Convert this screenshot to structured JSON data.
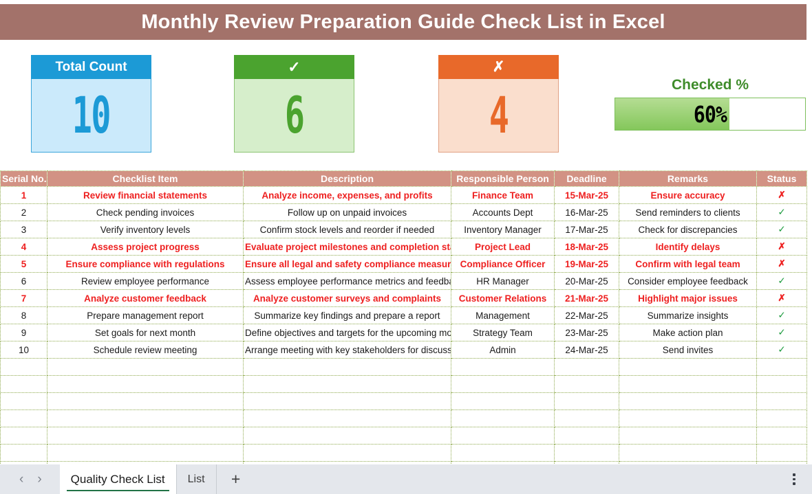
{
  "title": {
    "text": "Monthly Review Preparation Guide Check List in Excel"
  },
  "kpis": {
    "total": {
      "label": "Total Count",
      "value": "10",
      "color": "#1c9ad6"
    },
    "checked": {
      "label": "✓",
      "value": "6",
      "color": "#4ba32f"
    },
    "unchecked": {
      "label": "✗",
      "value": "4",
      "color": "#e8692a"
    }
  },
  "progress": {
    "label": "Checked %",
    "value_text": "60%",
    "percent": 60,
    "color": "#84c75b"
  },
  "table": {
    "headers": [
      "Serial No.",
      "Checklist Item",
      "Description",
      "Responsible Person",
      "Deadline",
      "Remarks",
      "Status"
    ],
    "rows": [
      {
        "serial": "1",
        "item": "Review financial statements",
        "desc": "Analyze income, expenses, and profits",
        "person": "Finance Team",
        "deadline": "15-Mar-25",
        "remarks": "Ensure accuracy",
        "status": "✗",
        "checked": false
      },
      {
        "serial": "2",
        "item": "Check pending invoices",
        "desc": "Follow up on unpaid invoices",
        "person": "Accounts Dept",
        "deadline": "16-Mar-25",
        "remarks": "Send reminders to clients",
        "status": "✓",
        "checked": true
      },
      {
        "serial": "3",
        "item": "Verify inventory levels",
        "desc": "Confirm stock levels and reorder if needed",
        "person": "Inventory Manager",
        "deadline": "17-Mar-25",
        "remarks": "Check for discrepancies",
        "status": "✓",
        "checked": true
      },
      {
        "serial": "4",
        "item": "Assess project progress",
        "desc": "Evaluate project milestones and completion status",
        "person": "Project Lead",
        "deadline": "18-Mar-25",
        "remarks": "Identify delays",
        "status": "✗",
        "checked": false
      },
      {
        "serial": "5",
        "item": "Ensure compliance with regulations",
        "desc": "Ensure all legal and safety compliance measures are met",
        "person": "Compliance Officer",
        "deadline": "19-Mar-25",
        "remarks": "Confirm with legal team",
        "status": "✗",
        "checked": false
      },
      {
        "serial": "6",
        "item": "Review employee performance",
        "desc": "Assess employee performance metrics and feedback",
        "person": "HR Manager",
        "deadline": "20-Mar-25",
        "remarks": "Consider employee feedback",
        "status": "✓",
        "checked": true
      },
      {
        "serial": "7",
        "item": "Analyze customer feedback",
        "desc": "Analyze customer surveys and complaints",
        "person": "Customer Relations",
        "deadline": "21-Mar-25",
        "remarks": "Highlight major issues",
        "status": "✗",
        "checked": false
      },
      {
        "serial": "8",
        "item": "Prepare management report",
        "desc": "Summarize key findings and prepare a report",
        "person": "Management",
        "deadline": "22-Mar-25",
        "remarks": "Summarize insights",
        "status": "✓",
        "checked": true
      },
      {
        "serial": "9",
        "item": "Set goals for next month",
        "desc": "Define objectives and targets for the upcoming month",
        "person": "Strategy Team",
        "deadline": "23-Mar-25",
        "remarks": "Make action plan",
        "status": "✓",
        "checked": true
      },
      {
        "serial": "10",
        "item": "Schedule review meeting",
        "desc": "Arrange meeting with key stakeholders for discussion",
        "person": "Admin",
        "deadline": "24-Mar-25",
        "remarks": "Send invites",
        "status": "✓",
        "checked": true
      }
    ],
    "empty_row_count": 7
  },
  "tabbar": {
    "prev_icon": "‹",
    "next_icon": "›",
    "tabs": [
      {
        "label": "Quality Check List",
        "active": true
      },
      {
        "label": "List",
        "active": false
      }
    ],
    "add_label": "+"
  }
}
